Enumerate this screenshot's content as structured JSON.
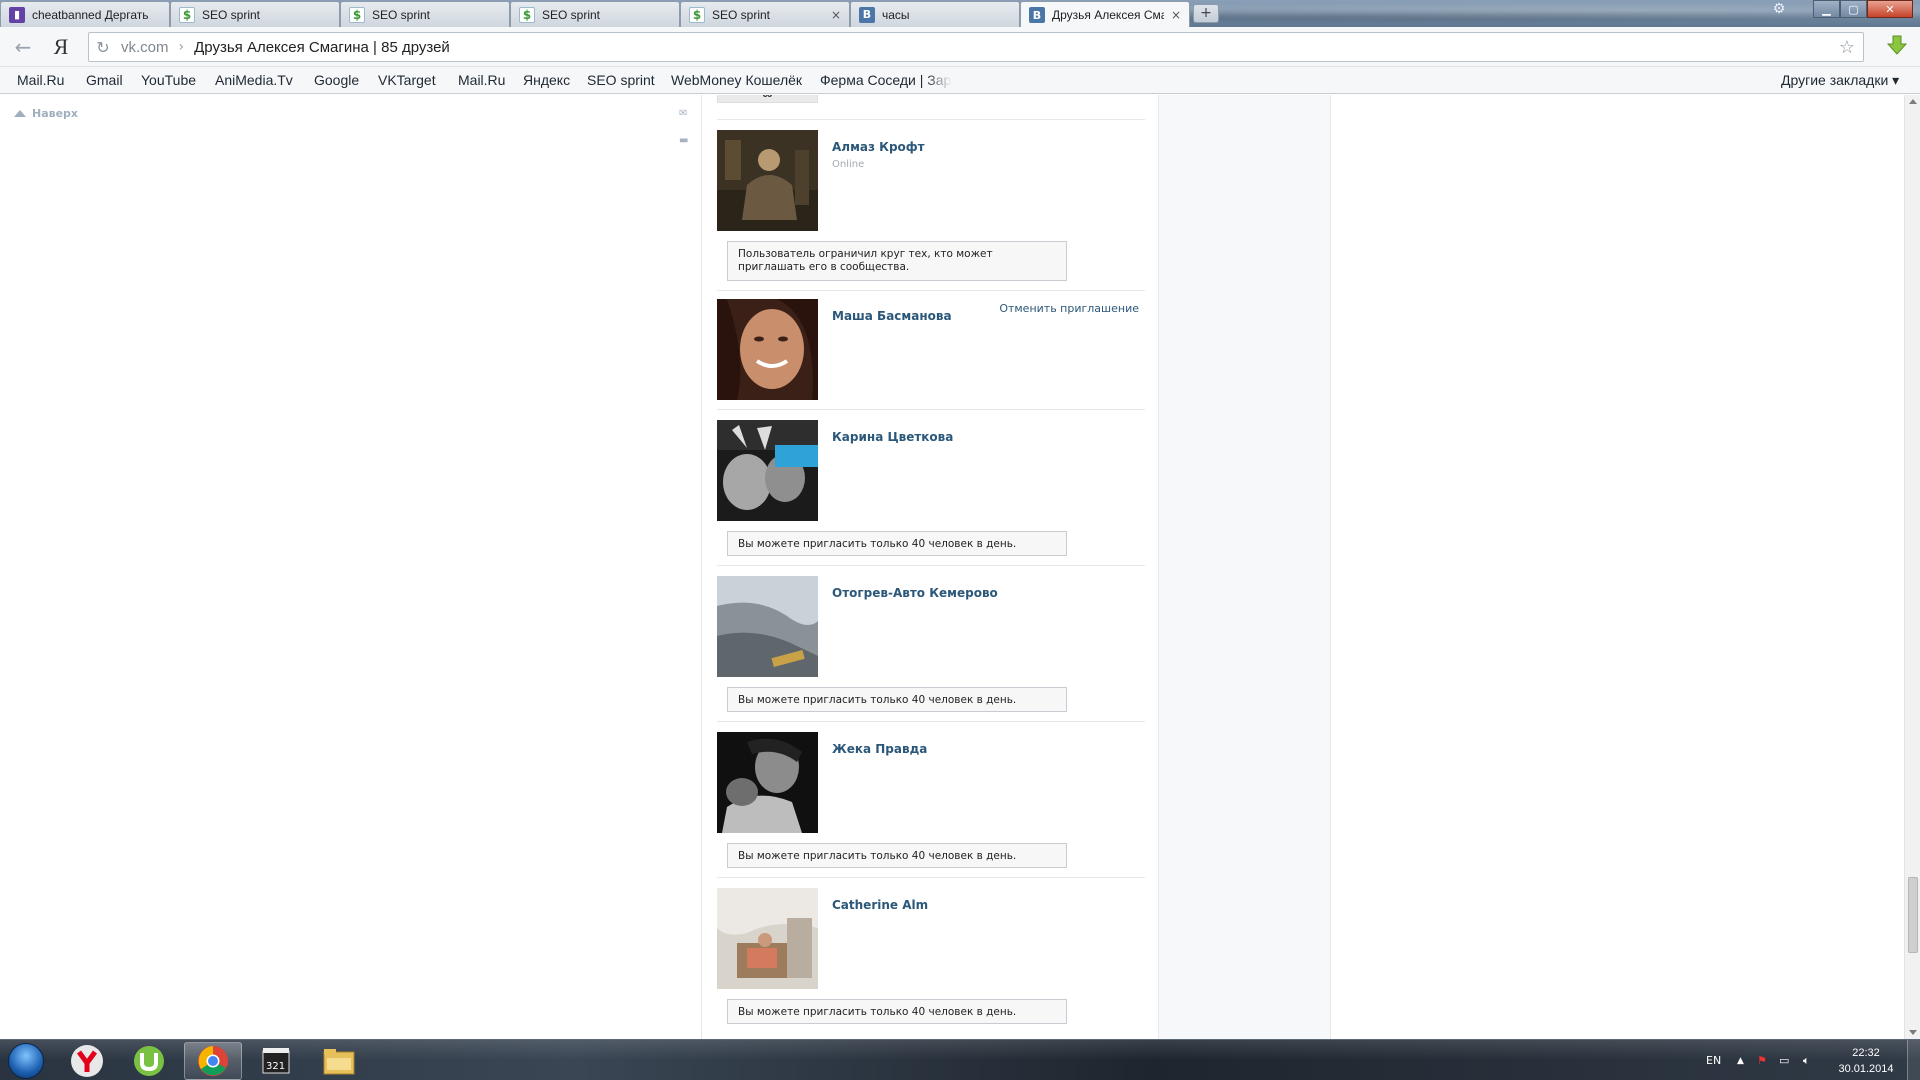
{
  "browser": {
    "tabs": [
      {
        "title": "cheatbanned Дергать",
        "favicon": "twitch-icon",
        "active": false
      },
      {
        "title": "SEO sprint",
        "favicon": "seosprint-icon",
        "active": false
      },
      {
        "title": "SEO sprint",
        "favicon": "seosprint-icon",
        "active": false
      },
      {
        "title": "SEO sprint",
        "favicon": "seosprint-icon",
        "active": false
      },
      {
        "title": "SEO sprint",
        "favicon": "seosprint-icon",
        "active": false
      },
      {
        "title": "часы",
        "favicon": "vk-icon",
        "active": false
      },
      {
        "title": "Друзья Алексея Смаг",
        "favicon": "vk-icon",
        "active": true
      }
    ],
    "tab_close_glyph": "×",
    "new_tab_glyph": "+",
    "yandex_logo": "Я",
    "address": {
      "host": "vk.com",
      "separator": "›",
      "page_title": "Друзья Алексея Смагина | 85 друзей"
    },
    "bookmarks": [
      "Mail.Ru",
      "Gmail",
      "YouTube",
      "AniMedia.Tv",
      "Google",
      "VKTarget",
      "Mail.Ru",
      "Яндекс",
      "SEO sprint",
      "WebMoney Кошелёк",
      "Ферма Соседи | Зар"
    ],
    "other_bookmarks": "Другие закладки ▾"
  },
  "page": {
    "scroll_top_label": "Наверх",
    "friends": [
      {
        "name": "Алмаз Крофт",
        "status": "Online",
        "action": "",
        "notice": "Пользователь ограничил круг тех, кто может приглашать его в сообщества."
      },
      {
        "name": "Маша Басманова",
        "status": "",
        "action": "Отменить приглашение",
        "notice": ""
      },
      {
        "name": "Карина Цветкова",
        "status": "",
        "action": "",
        "notice": "Вы можете пригласить только 40 человек в день."
      },
      {
        "name": "Отогрев-Авто Кемерово",
        "status": "",
        "action": "",
        "notice": "Вы можете пригласить только 40 человек в день."
      },
      {
        "name": "Жека Правда",
        "status": "",
        "action": "",
        "notice": "Вы можете пригласить только 40 человек в день."
      },
      {
        "name": "Catherine Alm",
        "status": "",
        "action": "",
        "notice": "Вы можете пригласить только 40 человек в день."
      }
    ]
  },
  "taskbar": {
    "apps": [
      "yandex-browser-icon",
      "utorrent-icon",
      "chrome-icon",
      "media-player-classic-icon",
      "file-explorer-icon"
    ],
    "language": "EN",
    "time": "22:32",
    "date": "30.01.2014"
  },
  "colors": {
    "vk_link": "#2b587a",
    "vk_accent": "#4a76a8",
    "muted": "#a3aab2"
  }
}
